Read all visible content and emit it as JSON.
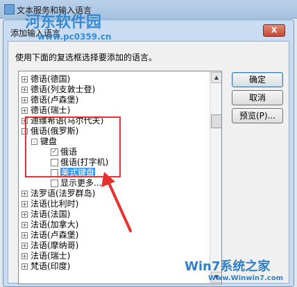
{
  "parent_window": {
    "title": "文本服务和输入语言"
  },
  "dialog": {
    "title": "添加输入语言",
    "close_label": "X",
    "instruction": "使用下面的复选框选择要添加的语言。",
    "buttons": {
      "ok": "确定",
      "cancel": "取消",
      "preview": "预览(P)..."
    }
  },
  "tree": {
    "items": [
      {
        "label": "德语(德国)",
        "expander": "+"
      },
      {
        "label": "德语(列支敦士登)",
        "expander": "+"
      },
      {
        "label": "德语(卢森堡)",
        "expander": "+"
      },
      {
        "label": "德语(瑞士)",
        "expander": "+"
      },
      {
        "label": "迪维希语(马尔代夫)",
        "expander": "+"
      },
      {
        "label": "俄语(俄罗斯)",
        "expander": "-"
      },
      {
        "label": "键盘",
        "expander": "-"
      },
      {
        "label": "俄语",
        "checked": true
      },
      {
        "label": "俄语(打字机)",
        "checked": false
      },
      {
        "label": "美式键盘",
        "checked": false,
        "selected": true
      },
      {
        "label": "显示更多...",
        "checked": false
      },
      {
        "label": "法罗语(法罗群岛)",
        "expander": "+"
      },
      {
        "label": "法语(比利时)",
        "expander": "+"
      },
      {
        "label": "法语(法国)",
        "expander": "+"
      },
      {
        "label": "法语(加拿大)",
        "expander": "+"
      },
      {
        "label": "法语(卢森堡)",
        "expander": "+"
      },
      {
        "label": "法语(摩纳哥)",
        "expander": "+"
      },
      {
        "label": "法语(瑞士)",
        "expander": "+"
      },
      {
        "label": "梵语(印度)",
        "expander": "+"
      }
    ]
  },
  "watermark_top": {
    "brand": "河东软件园",
    "url": "www.pc0359.cn"
  },
  "watermark_bottom": {
    "brand": "Win7系统之家",
    "url": "Www.Winwin7.com"
  },
  "colors": {
    "highlight": "#e83030",
    "selection": "#3399ff"
  }
}
